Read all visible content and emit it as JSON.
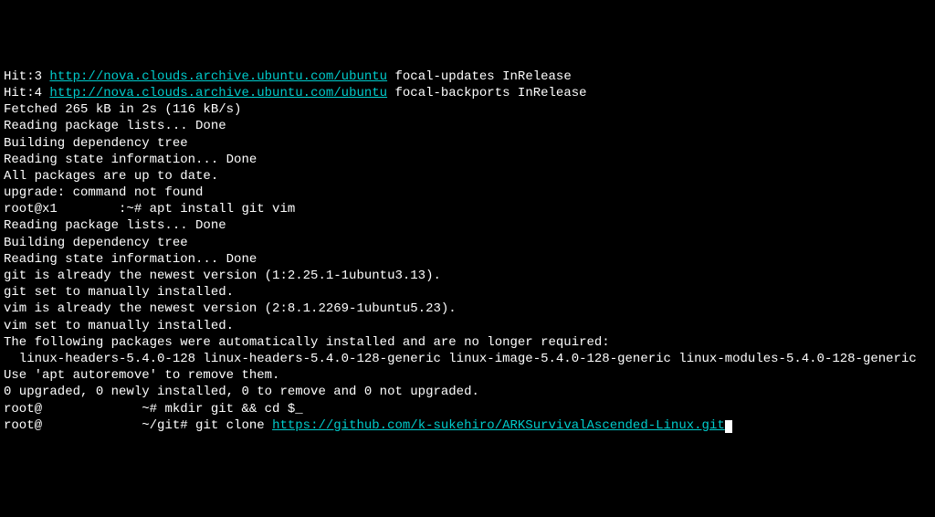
{
  "lines": {
    "l0_prefix": "Hit:3 ",
    "l0_link": "http://nova.clouds.archive.ubuntu.com/ubuntu",
    "l0_suffix": " focal-updates InRelease",
    "l1_prefix": "Hit:4 ",
    "l1_link": "http://nova.clouds.archive.ubuntu.com/ubuntu",
    "l1_suffix": " focal-backports InRelease",
    "l2": "Fetched 265 kB in 2s (116 kB/s)",
    "l3": "Reading package lists... Done",
    "l4": "Building dependency tree",
    "l5": "Reading state information... Done",
    "l6": "All packages are up to date.",
    "l7": "upgrade: command not found",
    "l8_prompt_a": "root@x1",
    "l8_redact": "        ",
    "l8_prompt_b": ":~# apt install git vim",
    "l9": "Reading package lists... Done",
    "l10": "Building dependency tree",
    "l11": "Reading state information... Done",
    "l12": "git is already the newest version (1:2.25.1-1ubuntu3.13).",
    "l13": "git set to manually installed.",
    "l14": "vim is already the newest version (2:8.1.2269-1ubuntu5.23).",
    "l15": "vim set to manually installed.",
    "l16": "The following packages were automatically installed and are no longer required:",
    "l17": "  linux-headers-5.4.0-128 linux-headers-5.4.0-128-generic linux-image-5.4.0-128-generic linux-modules-5.4.0-128-generic",
    "l18": "Use 'apt autoremove' to remove them.",
    "l19": "0 upgraded, 0 newly installed, 0 to remove and 0 not upgraded.",
    "l20_prompt_a": "root@",
    "l20_redact": "             ",
    "l20_prompt_b": "~# mkdir git && cd $_",
    "l21_prompt_a": "root@",
    "l21_redact": "             ",
    "l21_prompt_b": "~/git# git clone ",
    "l21_link": "https://github.com/k-sukehiro/ARKSurvivalAscended-Linux.git"
  }
}
